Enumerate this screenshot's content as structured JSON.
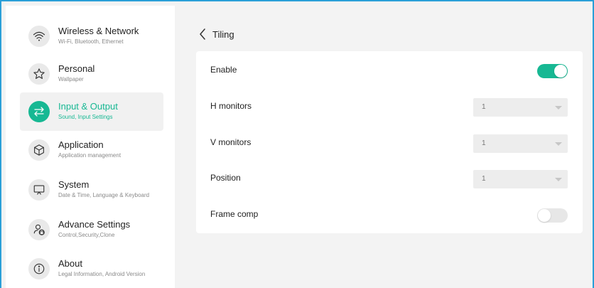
{
  "sidebar": {
    "items": [
      {
        "id": "wireless",
        "title": "Wireless & Network",
        "subtitle": "Wi-Fi, Bluetooth, Ethernet",
        "icon": "wifi-icon"
      },
      {
        "id": "personal",
        "title": "Personal",
        "subtitle": "Wallpaper",
        "icon": "star-icon"
      },
      {
        "id": "input-output",
        "title": "Input & Output",
        "subtitle": "Sound, Input Settings",
        "icon": "swap-arrows-icon",
        "active": true
      },
      {
        "id": "application",
        "title": "Application",
        "subtitle": "Application management",
        "icon": "cube-icon"
      },
      {
        "id": "system",
        "title": "System",
        "subtitle": "Date & Time, Language & Keyboard",
        "icon": "monitor-icon"
      },
      {
        "id": "advance",
        "title": "Advance Settings",
        "subtitle": "Control,Security,Clone",
        "icon": "user-lock-icon"
      },
      {
        "id": "about",
        "title": "About",
        "subtitle": "Legal Information, Android Version",
        "icon": "info-icon"
      }
    ]
  },
  "header": {
    "title": "Tiling",
    "back_icon": "chevron-left-icon"
  },
  "settings": {
    "enable": {
      "label": "Enable",
      "on": true
    },
    "h_monitors": {
      "label": "H monitors",
      "value": "1"
    },
    "v_monitors": {
      "label": "V monitors",
      "value": "1"
    },
    "position": {
      "label": "Position",
      "value": "1"
    },
    "frame_comp": {
      "label": "Frame comp",
      "on": false
    }
  },
  "colors": {
    "accent": "#17b893",
    "border": "#2a9fd8",
    "background": "#f3f3f3"
  }
}
